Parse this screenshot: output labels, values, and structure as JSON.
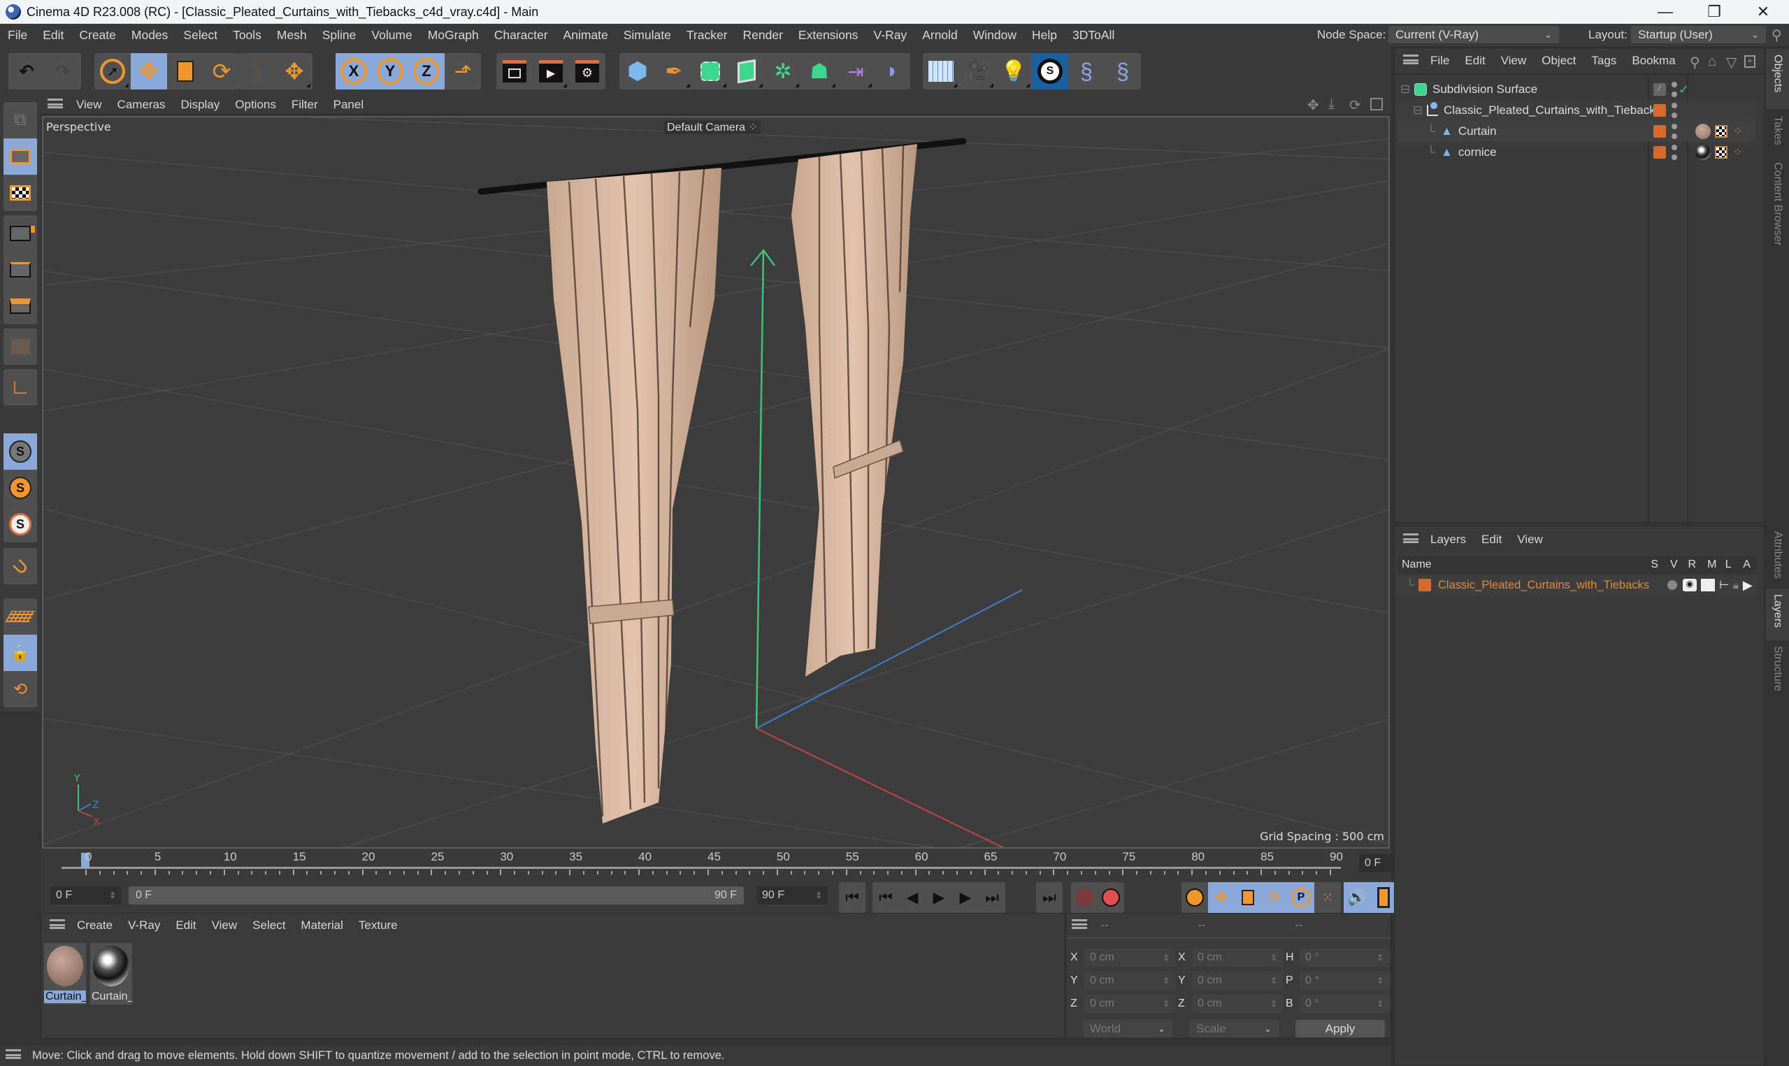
{
  "window": {
    "title": "Cinema 4D R23.008 (RC) - [Classic_Pleated_Curtains_with_Tiebacks_c4d_vray.c4d] - Main",
    "controls": [
      "minimize",
      "restore",
      "close"
    ]
  },
  "menubar": {
    "items": [
      "File",
      "Edit",
      "Create",
      "Modes",
      "Select",
      "Tools",
      "Mesh",
      "Spline",
      "Volume",
      "MoGraph",
      "Character",
      "Animate",
      "Simulate",
      "Tracker",
      "Render",
      "Extensions",
      "V-Ray",
      "Arnold",
      "Window",
      "Help",
      "3DToAll"
    ],
    "node_space_label": "Node Space:",
    "node_space_value": "Current (V-Ray)",
    "layout_label": "Layout:",
    "layout_value": "Startup (User)"
  },
  "toolbar": {
    "groups": [
      [
        "undo-icon",
        "redo-icon"
      ],
      [
        "live-selection-icon",
        "move-icon",
        "scale-icon",
        "rotate-icon"
      ],
      [
        "psr-icon",
        "last-tool-icon"
      ],
      [
        "x-axis-lock-icon",
        "y-axis-lock-icon",
        "z-axis-lock-icon",
        "coordinate-system-icon"
      ],
      [
        "render-view-icon",
        "render-picture-viewer-icon",
        "render-settings-icon"
      ],
      [
        "cube-icon",
        "pen-icon",
        "subdivision-icon",
        "extrude-icon",
        "cloner-icon",
        "voronoi-icon",
        "deformer-icon",
        "bend-icon"
      ],
      [
        "floor-icon",
        "camera-icon",
        "light-icon",
        "3dtoall-icon",
        "python-icon",
        "python-script-icon"
      ]
    ]
  },
  "left_tools": [
    "make-editable-icon",
    "model-mode-icon",
    "texture-mode-icon",
    "points-mode-icon",
    "edges-mode-icon",
    "polygons-mode-icon",
    "uv-mode-icon",
    "axis-mode-icon",
    "solo-off-icon",
    "solo-single-icon",
    "solo-hierarchy-icon",
    "snap-icon",
    "workplane-icon",
    "lock-workplane-icon",
    "align-workplane-icon"
  ],
  "viewport": {
    "menu": [
      "View",
      "Cameras",
      "Display",
      "Options",
      "Filter",
      "Panel"
    ],
    "name": "Perspective",
    "camera": "Default Camera",
    "grid_spacing": "Grid Spacing : 500 cm",
    "axis_labels": {
      "y": "Y",
      "z": "Z",
      "x": "X"
    },
    "nav_icons": [
      "pan-icon",
      "dolly-icon",
      "orbit-icon",
      "maximize-view-icon"
    ]
  },
  "timeline": {
    "ticks": [
      "0",
      "5",
      "10",
      "15",
      "20",
      "25",
      "30",
      "35",
      "40",
      "45",
      "50",
      "55",
      "60",
      "65",
      "70",
      "75",
      "80",
      "85",
      "90"
    ],
    "current_frame": "0 F",
    "start_frame": "0 F",
    "range_start": "0 F",
    "range_end": "90 F",
    "end_frame": "90 F"
  },
  "playback": {
    "buttons": [
      "go-to-start-icon",
      "previous-key-icon",
      "previous-frame-icon",
      "play-icon",
      "next-frame-icon",
      "next-key-icon",
      "go-to-end-icon",
      "record-active-icon",
      "autokey-icon",
      "keyframe-selection-icon",
      "position-key-icon",
      "scale-key-icon",
      "rotation-key-icon",
      "parameter-key-icon",
      "pla-key-icon",
      "sound-icon",
      "timeline-icon"
    ]
  },
  "material_manager": {
    "menu": [
      "Create",
      "V-Ray",
      "Edit",
      "View",
      "Select",
      "Material",
      "Texture"
    ],
    "materials": [
      {
        "name": "Curtain_",
        "type": "fabric",
        "selected": true
      },
      {
        "name": "Curtain_",
        "type": "chrome",
        "selected": false
      }
    ]
  },
  "coordinates": {
    "headers": [
      "--",
      "--",
      "--"
    ],
    "position": [
      {
        "axis": "X",
        "value": "0 cm"
      },
      {
        "axis": "Y",
        "value": "0 cm"
      },
      {
        "axis": "Z",
        "value": "0 cm"
      }
    ],
    "size": [
      {
        "axis": "X",
        "value": "0 cm"
      },
      {
        "axis": "Y",
        "value": "0 cm"
      },
      {
        "axis": "Z",
        "value": "0 cm"
      }
    ],
    "rotation": [
      {
        "axis": "H",
        "value": "0 °"
      },
      {
        "axis": "P",
        "value": "0 °"
      },
      {
        "axis": "B",
        "value": "0 °"
      }
    ],
    "space": "World",
    "mode": "Scale",
    "apply": "Apply"
  },
  "status": "Move: Click and drag to move elements. Hold down SHIFT to quantize movement / add to the selection in point mode, CTRL to remove.",
  "object_manager": {
    "menu": [
      "File",
      "Edit",
      "View",
      "Object",
      "Tags",
      "Bookma"
    ],
    "objects": [
      {
        "name": "Subdivision Surface",
        "depth": 0,
        "icon": "subdivision-surface-icon"
      },
      {
        "name": "Classic_Pleated_Curtains_with_Tiebacks",
        "depth": 1,
        "icon": "null-object-icon"
      },
      {
        "name": "Curtain",
        "depth": 2,
        "icon": "polygon-object-icon"
      },
      {
        "name": "cornice",
        "depth": 2,
        "icon": "polygon-object-icon"
      }
    ],
    "layer_color": "#d8692c"
  },
  "layer_manager": {
    "menu": [
      "Layers",
      "Edit",
      "View"
    ],
    "columns": [
      "Name",
      "S",
      "V",
      "R",
      "M",
      "L",
      "A"
    ],
    "layers": [
      {
        "name": "Classic_Pleated_Curtains_with_Tiebacks",
        "color": "#d8692c"
      }
    ]
  },
  "side_tabs": {
    "top": [
      "Objects",
      "Takes",
      "Content Browser"
    ],
    "bottom": [
      "Attributes",
      "Layers",
      "Structure"
    ]
  }
}
